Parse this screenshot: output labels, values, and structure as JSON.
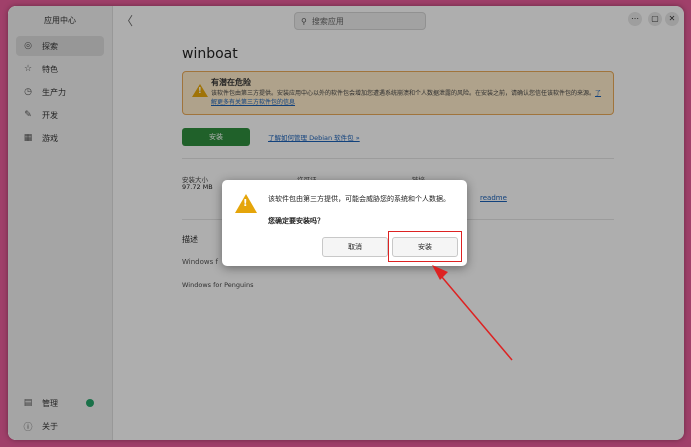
{
  "sidebar": {
    "title": "应用中心",
    "items": [
      {
        "label": "探索",
        "icon": "explore-icon",
        "glyph": "◎"
      },
      {
        "label": "特色",
        "icon": "star-icon",
        "glyph": "☆"
      },
      {
        "label": "生产力",
        "icon": "clock-icon",
        "glyph": "◷"
      },
      {
        "label": "开发",
        "icon": "wrench-icon",
        "glyph": "✎"
      },
      {
        "label": "游戏",
        "icon": "game-icon",
        "glyph": "▦"
      }
    ],
    "bottom": [
      {
        "label": "管理",
        "icon": "manage-icon",
        "glyph": "▤"
      },
      {
        "label": "关于",
        "icon": "info-icon",
        "glyph": "ⓘ"
      }
    ]
  },
  "header": {
    "back_glyph": "〈",
    "search_placeholder": "搜索应用",
    "controls": [
      "⋯",
      "—",
      "▢",
      "✕"
    ]
  },
  "app": {
    "name": "winboat",
    "warning": {
      "title": "有潜在危险",
      "text": "该软件包由第三方提供。安装应用中心以外的软件包会增加您遭遇系统崩溃和个人数据泄露的风险。在安装之前，请确认您信任该软件包的来源。",
      "link": "了解更多有关第三方软件包的信息"
    },
    "install_label": "安装",
    "help_link": "了解如何管理 Debian 软件包 »",
    "info": {
      "size_label": "安装大小",
      "size_value": "97.72 MB",
      "license_label": "许可证",
      "link_label": "链接",
      "readme": "readme"
    },
    "desc_heading": "描述",
    "desc_short": "Windows f",
    "desc_long": "Windows for Penguins"
  },
  "dialog": {
    "message": "该软件包由第三方提供，可能会威胁您的系统和个人数据。",
    "question": "您确定要安装吗？",
    "cancel": "取消",
    "confirm": "安装"
  },
  "colors": {
    "install_green": "#2e8b3d",
    "warning_bg": "#fbe9c8",
    "warning_border": "#e5a657",
    "highlight_red": "#dd2222"
  }
}
